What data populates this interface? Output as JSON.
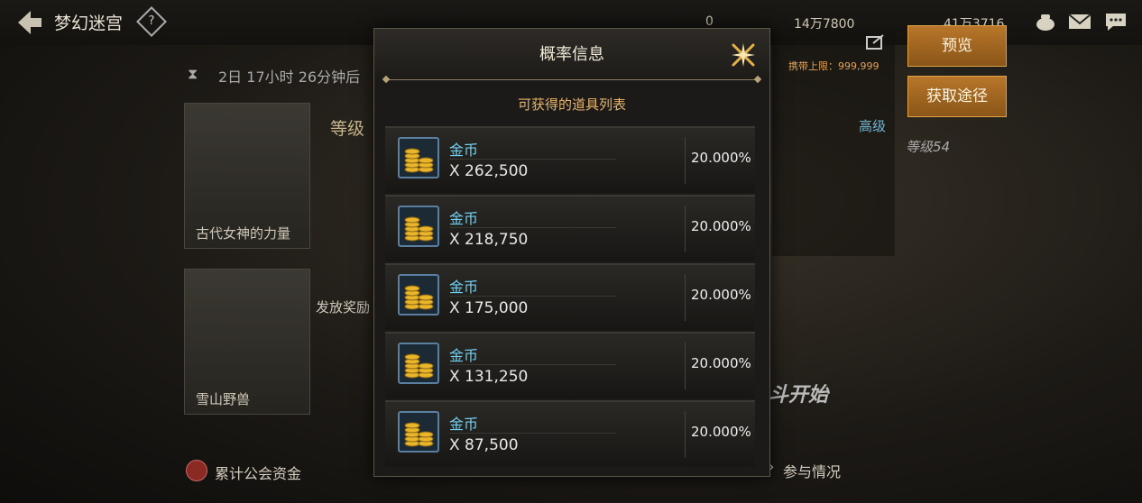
{
  "header": {
    "title": "梦幻迷宫",
    "help_label": "?",
    "resources": [
      "0",
      "14万7800",
      "41万3716"
    ]
  },
  "background": {
    "timer": "2日 17小时 26分钟后",
    "level_tag": "等级",
    "card1_name": "古代女神的力量",
    "card2_name": "雪山野兽",
    "reward_text": "发放奖励",
    "carry_limit": "携带上限：999,999",
    "grade": "高级",
    "level_right": "等级54",
    "start_banner": "斗开始",
    "footer_fund": "累计公会资金",
    "footer_participation": "参与情况"
  },
  "side_buttons": {
    "preview": "预览",
    "get_route": "获取途径"
  },
  "modal": {
    "title": "概率信息",
    "subtitle": "可获得的道具列表",
    "items": [
      {
        "name": "金币",
        "qty": "X 262,500",
        "prob": "20.000%"
      },
      {
        "name": "金币",
        "qty": "X 218,750",
        "prob": "20.000%"
      },
      {
        "name": "金币",
        "qty": "X 175,000",
        "prob": "20.000%"
      },
      {
        "name": "金币",
        "qty": "X 131,250",
        "prob": "20.000%"
      },
      {
        "name": "金币",
        "qty": "X 87,500",
        "prob": "20.000%"
      }
    ]
  },
  "colors": {
    "accent_gold": "#e6b46a",
    "item_name": "#6fd0f2",
    "button_orange": "#b8762a"
  },
  "icons": [
    "back-arrow-icon",
    "help-icon",
    "gold-coins-icon",
    "close-icon",
    "mail-icon",
    "chat-icon",
    "pot-icon",
    "edit-icon"
  ]
}
